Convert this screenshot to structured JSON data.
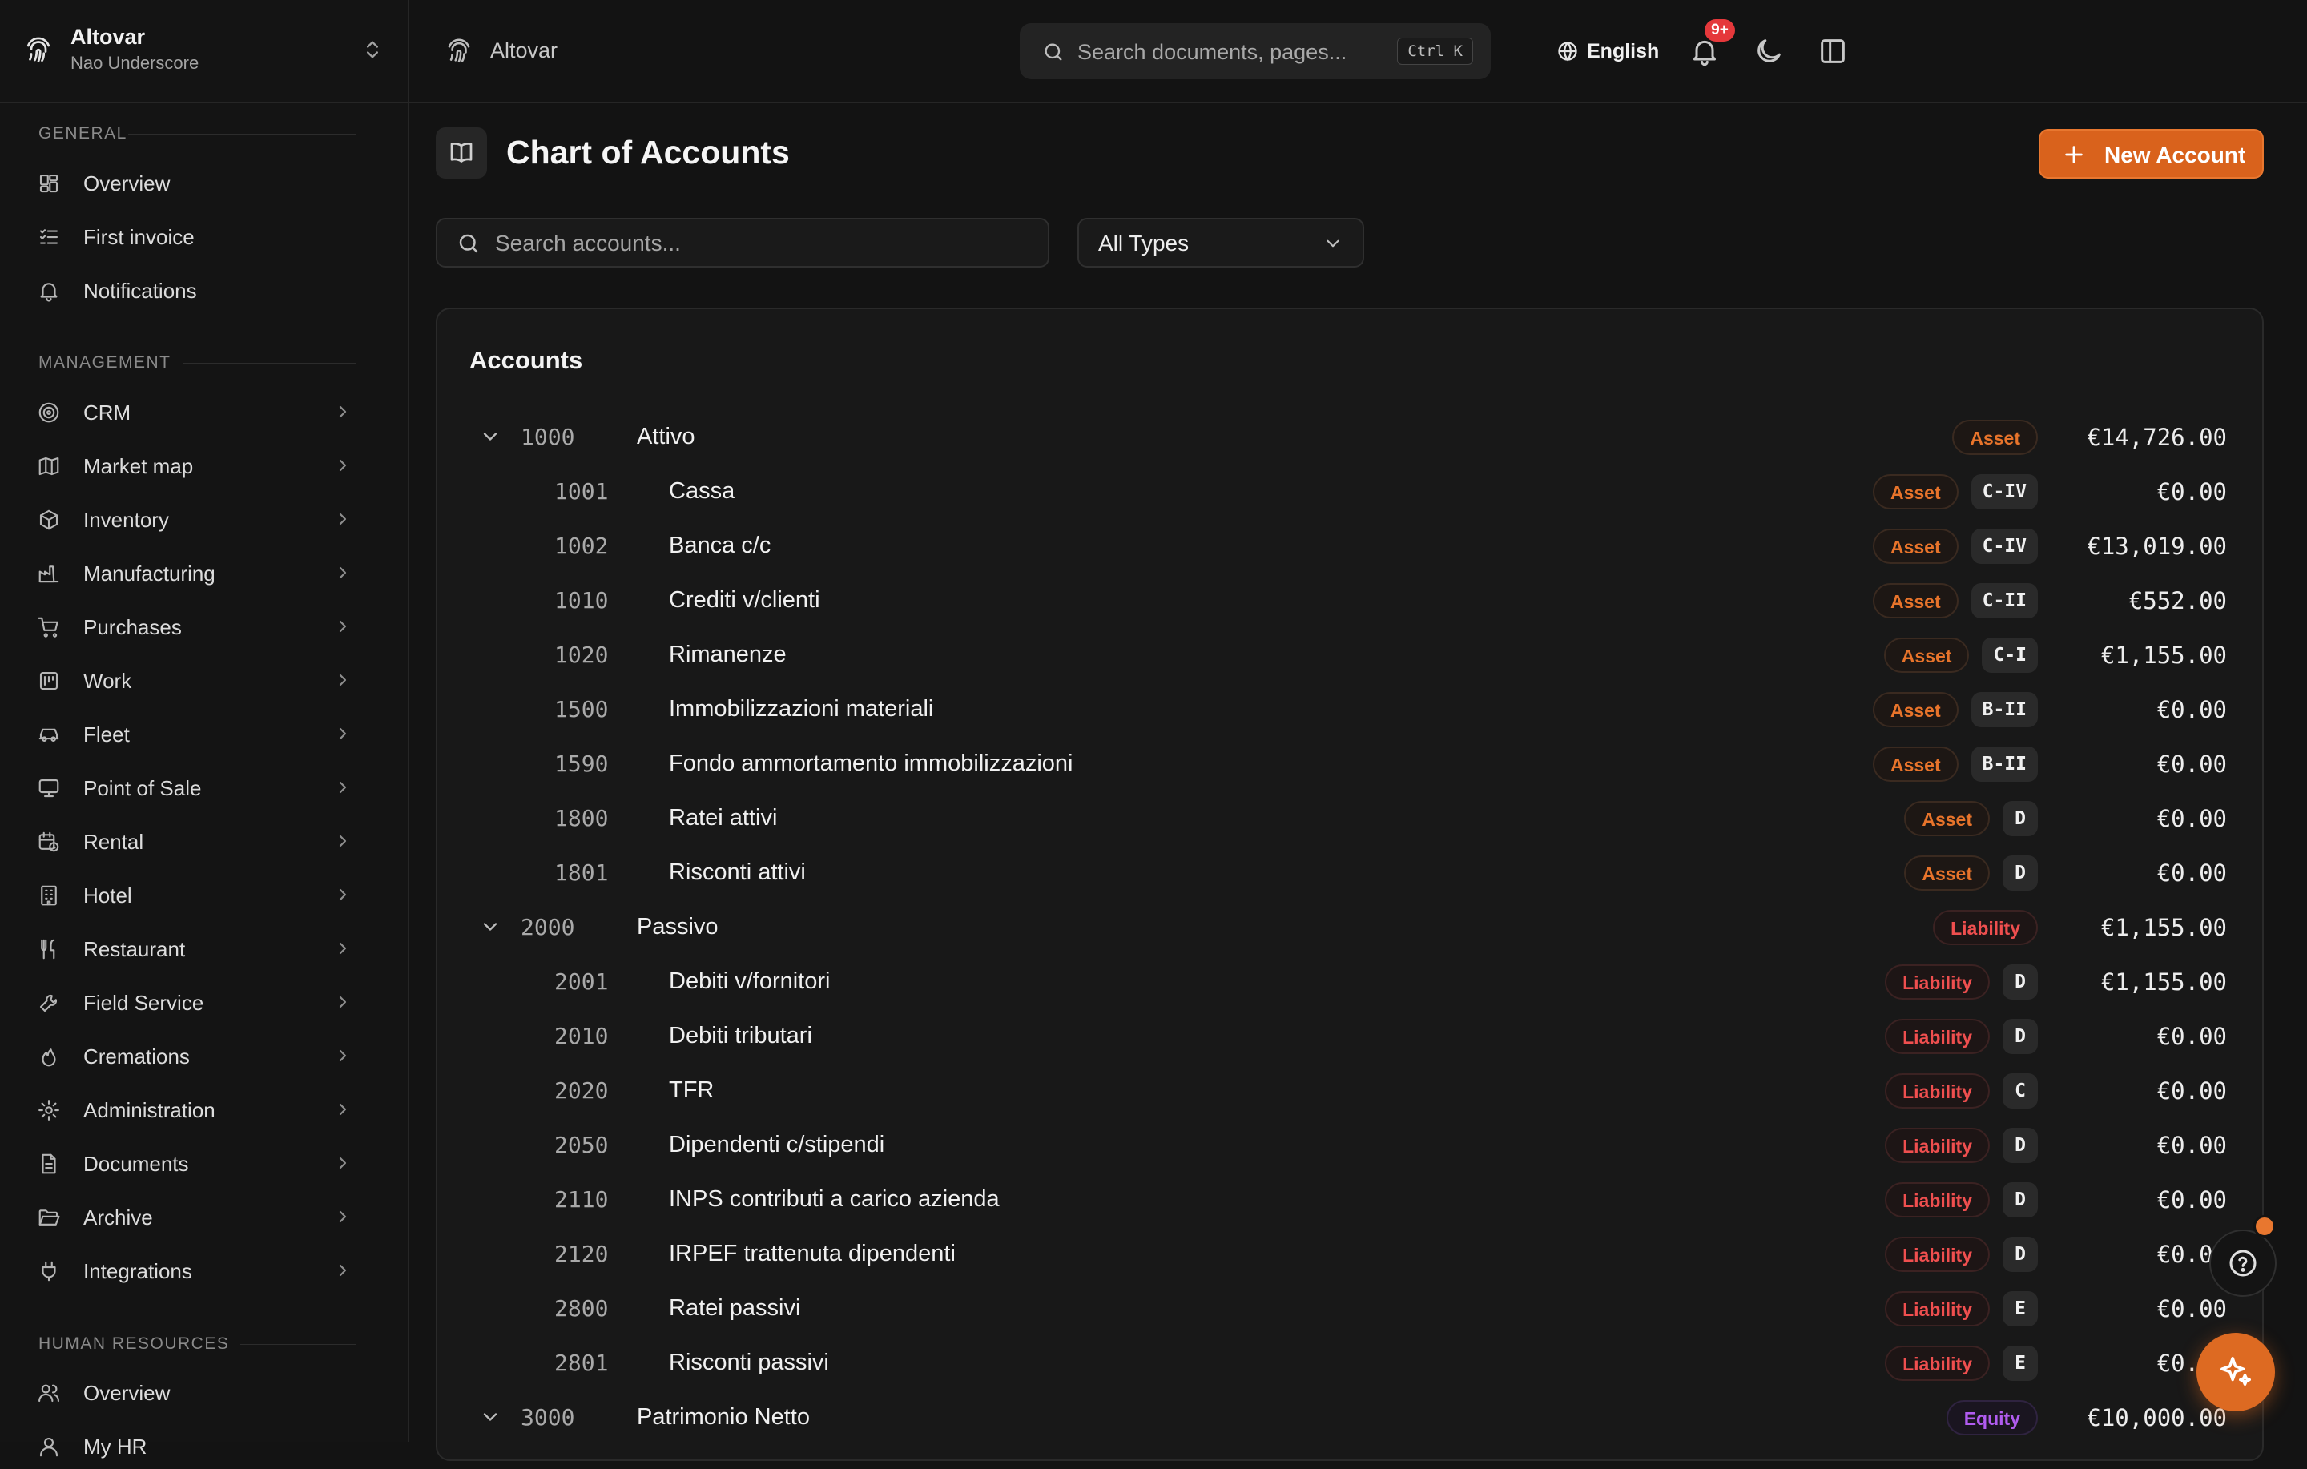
{
  "workspace": {
    "name": "Altovar",
    "user": "Nao Underscore"
  },
  "topbar": {
    "title": "Altovar",
    "search_placeholder": "Search documents, pages...",
    "shortcut": "Ctrl K",
    "language": "English",
    "notifications_badge": "9+"
  },
  "sidebar": {
    "general_heading": "GENERAL",
    "general_items": [
      {
        "label": "Overview",
        "icon": "dashboard-icon"
      },
      {
        "label": "First invoice",
        "icon": "checklist-icon"
      },
      {
        "label": "Notifications",
        "icon": "bell-icon"
      }
    ],
    "management_heading": "MANAGEMENT",
    "management_items": [
      {
        "label": "CRM",
        "icon": "target-icon"
      },
      {
        "label": "Market map",
        "icon": "map-icon"
      },
      {
        "label": "Inventory",
        "icon": "box-icon"
      },
      {
        "label": "Manufacturing",
        "icon": "factory-icon"
      },
      {
        "label": "Purchases",
        "icon": "cart-icon"
      },
      {
        "label": "Work",
        "icon": "kanban-icon"
      },
      {
        "label": "Fleet",
        "icon": "car-icon"
      },
      {
        "label": "Point of Sale",
        "icon": "monitor-icon"
      },
      {
        "label": "Rental",
        "icon": "calendar-clock-icon"
      },
      {
        "label": "Hotel",
        "icon": "building-icon"
      },
      {
        "label": "Restaurant",
        "icon": "utensils-icon"
      },
      {
        "label": "Field Service",
        "icon": "wrench-icon"
      },
      {
        "label": "Cremations",
        "icon": "flame-icon"
      },
      {
        "label": "Administration",
        "icon": "gear-icon"
      },
      {
        "label": "Documents",
        "icon": "file-icon"
      },
      {
        "label": "Archive",
        "icon": "folder-open-icon"
      },
      {
        "label": "Integrations",
        "icon": "plug-icon"
      }
    ],
    "hr_heading": "HUMAN RESOURCES",
    "hr_items": [
      {
        "label": "Overview",
        "icon": "users-icon"
      },
      {
        "label": "My HR",
        "icon": "user-icon"
      }
    ]
  },
  "page": {
    "title": "Chart of Accounts",
    "new_button": "New Account",
    "search_placeholder": "Search accounts...",
    "type_filter": "All Types",
    "card_title": "Accounts"
  },
  "accounts": [
    {
      "level": "group",
      "code": "1000",
      "name": "Attivo",
      "type": "Asset",
      "section": "",
      "balance": "€14,726.00"
    },
    {
      "level": "child",
      "code": "1001",
      "name": "Cassa",
      "type": "Asset",
      "section": "C-IV",
      "balance": "€0.00"
    },
    {
      "level": "child",
      "code": "1002",
      "name": "Banca c/c",
      "type": "Asset",
      "section": "C-IV",
      "balance": "€13,019.00"
    },
    {
      "level": "child",
      "code": "1010",
      "name": "Crediti v/clienti",
      "type": "Asset",
      "section": "C-II",
      "balance": "€552.00"
    },
    {
      "level": "child",
      "code": "1020",
      "name": "Rimanenze",
      "type": "Asset",
      "section": "C-I",
      "balance": "€1,155.00"
    },
    {
      "level": "child",
      "code": "1500",
      "name": "Immobilizzazioni materiali",
      "type": "Asset",
      "section": "B-II",
      "balance": "€0.00"
    },
    {
      "level": "child",
      "code": "1590",
      "name": "Fondo ammortamento immobilizzazioni",
      "type": "Asset",
      "section": "B-II",
      "balance": "€0.00"
    },
    {
      "level": "child",
      "code": "1800",
      "name": "Ratei attivi",
      "type": "Asset",
      "section": "D",
      "balance": "€0.00"
    },
    {
      "level": "child",
      "code": "1801",
      "name": "Risconti attivi",
      "type": "Asset",
      "section": "D",
      "balance": "€0.00"
    },
    {
      "level": "group",
      "code": "2000",
      "name": "Passivo",
      "type": "Liability",
      "section": "",
      "balance": "€1,155.00"
    },
    {
      "level": "child",
      "code": "2001",
      "name": "Debiti v/fornitori",
      "type": "Liability",
      "section": "D",
      "balance": "€1,155.00"
    },
    {
      "level": "child",
      "code": "2010",
      "name": "Debiti tributari",
      "type": "Liability",
      "section": "D",
      "balance": "€0.00"
    },
    {
      "level": "child",
      "code": "2020",
      "name": "TFR",
      "type": "Liability",
      "section": "C",
      "balance": "€0.00"
    },
    {
      "level": "child",
      "code": "2050",
      "name": "Dipendenti c/stipendi",
      "type": "Liability",
      "section": "D",
      "balance": "€0.00"
    },
    {
      "level": "child",
      "code": "2110",
      "name": "INPS contributi a carico azienda",
      "type": "Liability",
      "section": "D",
      "balance": "€0.00"
    },
    {
      "level": "child",
      "code": "2120",
      "name": "IRPEF trattenuta dipendenti",
      "type": "Liability",
      "section": "D",
      "balance": "€0.00"
    },
    {
      "level": "child",
      "code": "2800",
      "name": "Ratei passivi",
      "type": "Liability",
      "section": "E",
      "balance": "€0.00"
    },
    {
      "level": "child",
      "code": "2801",
      "name": "Risconti passivi",
      "type": "Liability",
      "section": "E",
      "balance": "€0.00"
    },
    {
      "level": "group",
      "code": "3000",
      "name": "Patrimonio Netto",
      "type": "Equity",
      "section": "",
      "balance": "€10,000.00"
    }
  ],
  "colors": {
    "accent": "#d9621c",
    "asset": "#e8742b",
    "liability": "#ef4f4f",
    "equity": "#b15cf0"
  }
}
